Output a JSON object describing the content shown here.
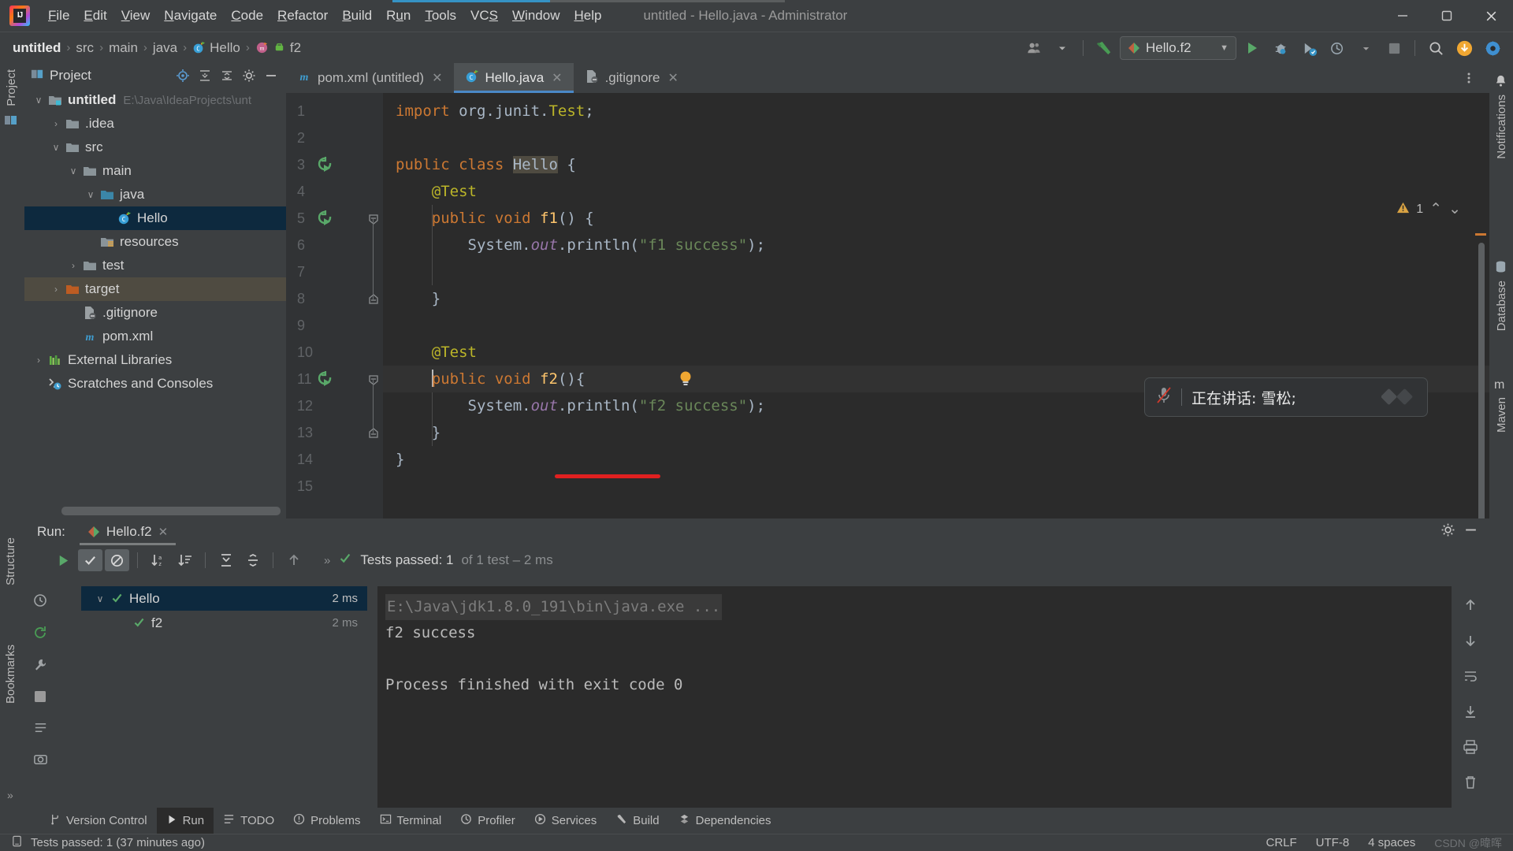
{
  "titlebar": {
    "logo_icon": "intellij-idea-logo",
    "menus": [
      {
        "label": "File",
        "mnemonic": "F"
      },
      {
        "label": "Edit",
        "mnemonic": "E"
      },
      {
        "label": "View",
        "mnemonic": "V"
      },
      {
        "label": "Navigate",
        "mnemonic": "N"
      },
      {
        "label": "Code",
        "mnemonic": "C"
      },
      {
        "label": "Refactor",
        "mnemonic": "R"
      },
      {
        "label": "Build",
        "mnemonic": "B"
      },
      {
        "label": "Run",
        "mnemonic": "u"
      },
      {
        "label": "Tools",
        "mnemonic": "T"
      },
      {
        "label": "VCS",
        "mnemonic": "S"
      },
      {
        "label": "Window",
        "mnemonic": "W"
      },
      {
        "label": "Help",
        "mnemonic": "H"
      }
    ],
    "window_title": "untitled - Hello.java - Administrator",
    "minimize_label": "—",
    "maximize_label": "❐",
    "close_label": "✕"
  },
  "navbar": {
    "breadcrumbs": [
      {
        "label": "untitled",
        "icon": ""
      },
      {
        "label": "src",
        "icon": ""
      },
      {
        "label": "main",
        "icon": ""
      },
      {
        "label": "java",
        "icon": ""
      },
      {
        "label": "Hello",
        "icon": "java-class-icon"
      },
      {
        "label": "f2",
        "icon": "method-icon"
      }
    ],
    "separator": "›",
    "run_config": "Hello.f2",
    "run_config_dropdown": "▼",
    "icons": [
      "user-icon",
      "build-hammer-icon",
      "run-icon",
      "debug-icon",
      "run-coverage-icon",
      "profiler-icon",
      "stop-icon",
      "search-icon",
      "update-icon",
      "settings-icon"
    ]
  },
  "left_strips": {
    "project_label": "Project",
    "structure_label": "Structure",
    "bookmarks_label": "Bookmarks",
    "more_label": "»"
  },
  "right_strips": {
    "notifications_label": "Notifications",
    "database_label": "Database",
    "maven_label": "Maven"
  },
  "project_panel": {
    "title": "Project",
    "header_icons": [
      "locate-icon",
      "expand-icon",
      "collapse-icon",
      "gear-icon",
      "hide-icon"
    ],
    "tree": [
      {
        "label": "untitled",
        "path": "E:\\Java\\IdeaProjects\\unt",
        "depth": 0,
        "twist": "∨",
        "icon": "module-folder-icon",
        "bold": true,
        "state": "normal"
      },
      {
        "label": ".idea",
        "path": "",
        "depth": 1,
        "twist": "›",
        "icon": "folder-icon",
        "bold": false,
        "state": "normal"
      },
      {
        "label": "src",
        "path": "",
        "depth": 1,
        "twist": "∨",
        "icon": "folder-icon",
        "bold": false,
        "state": "normal"
      },
      {
        "label": "main",
        "path": "",
        "depth": 2,
        "twist": "∨",
        "icon": "folder-icon",
        "bold": false,
        "state": "normal"
      },
      {
        "label": "java",
        "path": "",
        "depth": 3,
        "twist": "∨",
        "icon": "source-folder-icon",
        "bold": false,
        "state": "normal"
      },
      {
        "label": "Hello",
        "path": "",
        "depth": 4,
        "twist": "",
        "icon": "java-class-icon",
        "bold": false,
        "state": "selected"
      },
      {
        "label": "resources",
        "path": "",
        "depth": 3,
        "twist": "",
        "icon": "resources-folder-icon",
        "bold": false,
        "state": "normal"
      },
      {
        "label": "test",
        "path": "",
        "depth": 2,
        "twist": "›",
        "icon": "folder-icon",
        "bold": false,
        "state": "normal"
      },
      {
        "label": "target",
        "path": "",
        "depth": 1,
        "twist": "›",
        "icon": "excluded-folder-icon",
        "bold": false,
        "state": "highlight"
      },
      {
        "label": ".gitignore",
        "path": "",
        "depth": 2,
        "twist": "",
        "icon": "gitignore-icon",
        "bold": false,
        "state": "normal"
      },
      {
        "label": "pom.xml",
        "path": "",
        "depth": 2,
        "twist": "",
        "icon": "maven-icon",
        "bold": false,
        "state": "normal"
      },
      {
        "label": "External Libraries",
        "path": "",
        "depth": 0,
        "twist": "›",
        "icon": "libraries-icon",
        "bold": false,
        "state": "normal"
      },
      {
        "label": "Scratches and Consoles",
        "path": "",
        "depth": 0,
        "twist": "",
        "icon": "scratches-icon",
        "bold": false,
        "state": "normal"
      }
    ]
  },
  "editor": {
    "tabs": [
      {
        "label": "pom.xml (untitled)",
        "icon": "maven-icon",
        "active": false,
        "close": "✕"
      },
      {
        "label": "Hello.java",
        "icon": "java-class-icon",
        "active": true,
        "close": "✕"
      },
      {
        "label": ".gitignore",
        "icon": "gitignore-icon",
        "active": false,
        "close": "✕"
      }
    ],
    "tabs_more_icon": "more-vertical-icon",
    "inspection_warning_count": "1",
    "inspection_warning_icon": "warning-triangle-icon",
    "inspection_up_icon": "⌃",
    "inspection_down_icon": "⌄",
    "lines": [
      {
        "n": "1",
        "html": "<span class=\"kw\">import</span> <span class=\"id\">org.junit.</span><span class=\"ann\">Test</span><span class=\"id\">;</span>"
      },
      {
        "n": "2",
        "html": ""
      },
      {
        "n": "3",
        "html": "<span class=\"kw\">public class</span> <span class=\"hlid\">Hello</span> <span class=\"id\">{</span>"
      },
      {
        "n": "4",
        "html": "    <span class=\"ann\">@Test</span>"
      },
      {
        "n": "5",
        "html": "    <span class=\"kw\">public void</span> <span class=\"mth\">f1</span><span class=\"id\">() {</span>"
      },
      {
        "n": "6",
        "html": "        <span class=\"id\">System.</span><span class=\"fld\">out</span><span class=\"id\">.println(</span><span class=\"str\">\"f1 success\"</span><span class=\"id\">);</span>"
      },
      {
        "n": "7",
        "html": ""
      },
      {
        "n": "8",
        "html": "    <span class=\"id\">}</span>"
      },
      {
        "n": "9",
        "html": ""
      },
      {
        "n": "10",
        "html": "    <span class=\"ann\">@Test</span>"
      },
      {
        "n": "11",
        "html": "    <span class=\"caret\"></span><span class=\"kw\">public void</span> <span class=\"mth\">f2</span><span class=\"id\">(){</span>"
      },
      {
        "n": "12",
        "html": "        <span class=\"id\">System.</span><span class=\"fld\">out</span><span class=\"id\">.println(</span><span class=\"str\">\"f2 success\"</span><span class=\"id\">);</span>"
      },
      {
        "n": "13",
        "html": "    <span class=\"id\">}</span>"
      },
      {
        "n": "14",
        "html": "<span class=\"id\">}</span>"
      },
      {
        "n": "15",
        "html": ""
      }
    ],
    "gutter_run_icons": [
      3,
      5,
      11
    ],
    "fold_lines": [
      5,
      8,
      11,
      13
    ],
    "bulb_line": 11,
    "caret_line": 11,
    "red_annotation": true
  },
  "toast": {
    "mic_icon": "microphone-muted-icon",
    "text": "正在讲话: 雪松;",
    "logo_icon": "meeting-app-logo"
  },
  "run_window": {
    "label": "Run:",
    "tab_label": "Hello.f2",
    "tab_icon": "run-config-icon",
    "tab_close": "✕",
    "settings_icon": "gear-icon",
    "hide_icon": "minimize-icon",
    "toolbar_icons": [
      "rerun-icon",
      "show-passed-icon",
      "show-ignored-icon",
      "sort-alpha-icon",
      "sort-duration-icon",
      "expand-all-icon",
      "collapse-all-icon",
      "up-icon"
    ],
    "expand_chevrons": "»",
    "status_check_icon": "check-icon",
    "status_text": "Tests passed: 1",
    "status_dim": "of 1 test – 2 ms",
    "test_tree": [
      {
        "label": "Hello",
        "duration": "2 ms",
        "twist": "∨",
        "icon": "check-icon",
        "depth": 0,
        "selected": true
      },
      {
        "label": "f2",
        "duration": "2 ms",
        "twist": "",
        "icon": "check-icon",
        "depth": 1,
        "selected": false
      }
    ],
    "console": {
      "command": "E:\\Java\\jdk1.8.0_191\\bin\\java.exe ...",
      "lines": [
        "f2 success",
        "",
        "Process finished with exit code 0"
      ]
    },
    "left_strip_icons": [
      "history-icon",
      "rerun-tests-icon",
      "settings-wrench-icon",
      "stop-square-icon",
      "thread-dump-icon",
      "camera-icon"
    ],
    "right_strip_icons": [
      "scroll-up-icon",
      "scroll-down-icon",
      "soft-wrap-icon",
      "scroll-end-icon",
      "print-icon",
      "trash-icon"
    ]
  },
  "bottom_windows": [
    {
      "label": "Version Control",
      "icon": "branch-icon",
      "active": false
    },
    {
      "label": "Run",
      "icon": "run-icon",
      "active": true
    },
    {
      "label": "TODO",
      "icon": "todo-icon",
      "active": false
    },
    {
      "label": "Problems",
      "icon": "problems-icon",
      "active": false
    },
    {
      "label": "Terminal",
      "icon": "terminal-icon",
      "active": false
    },
    {
      "label": "Profiler",
      "icon": "profiler-icon",
      "active": false
    },
    {
      "label": "Services",
      "icon": "services-icon",
      "active": false
    },
    {
      "label": "Build",
      "icon": "build-icon",
      "active": false
    },
    {
      "label": "Dependencies",
      "icon": "dependencies-icon",
      "active": false
    }
  ],
  "status_bar": {
    "icon": "event-log-icon",
    "message": "Tests passed: 1 (37 minutes ago)",
    "line_separator": "CRLF",
    "encoding": "UTF-8",
    "indent": "4 spaces",
    "watermark": "CSDN @暐晖"
  },
  "colors": {
    "bg_panel": "#3c3f41",
    "bg_editor": "#2b2b2b",
    "accent_blue": "#4a88c7",
    "selection_blue": "#0d293e",
    "keyword_orange": "#cc7832",
    "string_green": "#6a8759",
    "annotation_yellow": "#bbb529",
    "method_yellow": "#ffc66d",
    "success_green": "#59a869",
    "error_red": "#e02020"
  }
}
